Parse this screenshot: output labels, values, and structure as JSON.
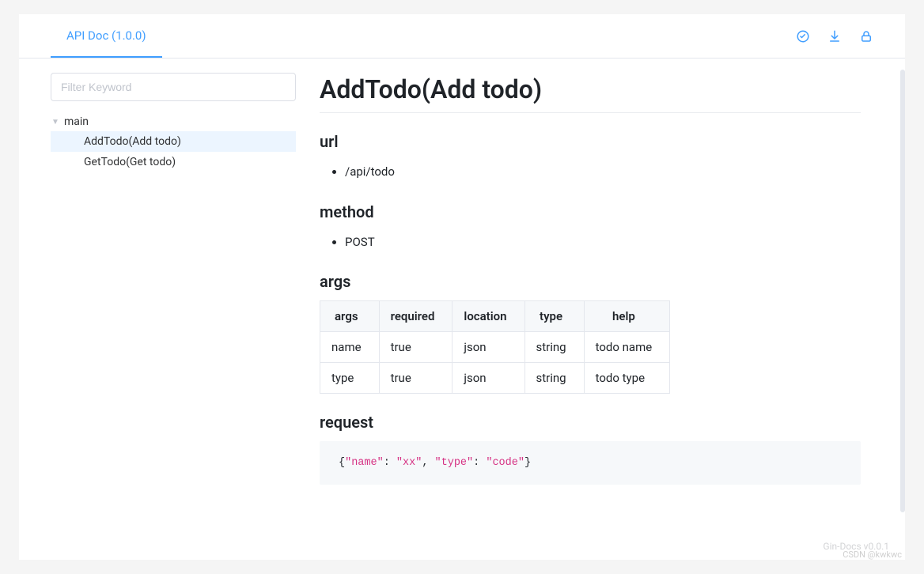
{
  "header": {
    "tab_title": "API Doc (1.0.0)"
  },
  "search": {
    "placeholder": "Filter Keyword"
  },
  "sidebar": {
    "group": "main",
    "items": [
      {
        "label": "AddTodo(Add todo)",
        "selected": true
      },
      {
        "label": "GetTodo(Get todo)",
        "selected": false
      }
    ]
  },
  "content": {
    "title": "AddTodo(Add todo)",
    "sections": {
      "url": {
        "heading": "url",
        "value": "/api/todo"
      },
      "method": {
        "heading": "method",
        "value": "POST"
      },
      "args": {
        "heading": "args",
        "columns": [
          "args",
          "required",
          "location",
          "type",
          "help"
        ],
        "rows": [
          [
            "name",
            "true",
            "json",
            "string",
            "todo name"
          ],
          [
            "type",
            "true",
            "json",
            "string",
            "todo type"
          ]
        ]
      },
      "request": {
        "heading": "request",
        "code": {
          "plain": "{\"name\": \"xx\", \"type\": \"code\"}",
          "tokens": [
            {
              "t": "{",
              "c": "punc"
            },
            {
              "t": "\"name\"",
              "c": "str"
            },
            {
              "t": ": ",
              "c": "punc"
            },
            {
              "t": "\"xx\"",
              "c": "str"
            },
            {
              "t": ", ",
              "c": "punc"
            },
            {
              "t": "\"type\"",
              "c": "str"
            },
            {
              "t": ": ",
              "c": "punc"
            },
            {
              "t": "\"code\"",
              "c": "str"
            },
            {
              "t": "}",
              "c": "punc"
            }
          ]
        }
      }
    }
  },
  "footer": {
    "brand": "Gin-Docs v0.0.1",
    "watermark": "CSDN @kwkwc"
  }
}
